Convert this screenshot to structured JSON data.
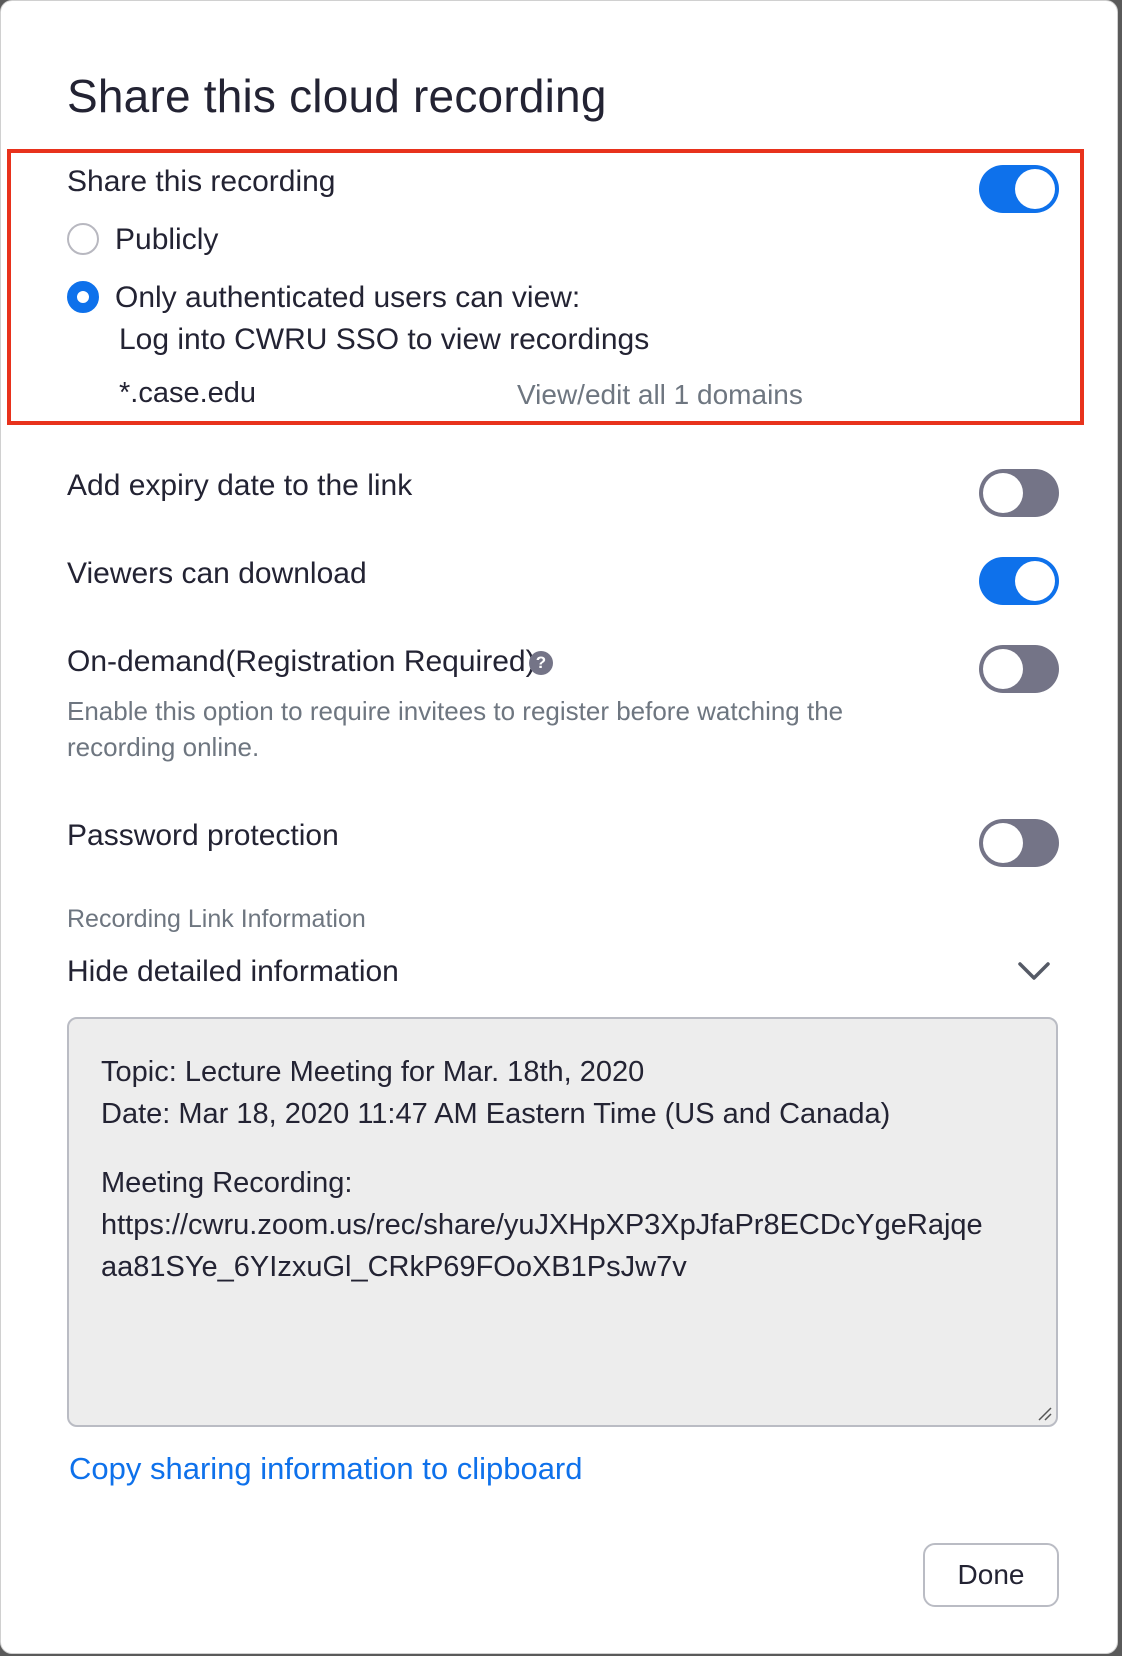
{
  "dialog": {
    "title": "Share this cloud recording"
  },
  "share": {
    "label": "Share this recording",
    "enabled": true,
    "options": [
      {
        "label": "Publicly",
        "selected": false
      },
      {
        "label": "Only authenticated users can view:",
        "selected": true
      }
    ],
    "auth_profile": "Log into CWRU SSO to view recordings",
    "domain": "*.case.edu",
    "domains_link": "View/edit all 1 domains"
  },
  "settings": {
    "expiry": {
      "label": "Add expiry date to the link",
      "enabled": false
    },
    "download": {
      "label": "Viewers can download",
      "enabled": true
    },
    "on_demand": {
      "label": "On-demand(Registration Required)",
      "help_glyph": "?",
      "description": "Enable this option to require invitees to register before watching the recording online.",
      "enabled": false
    },
    "password": {
      "label": "Password protection",
      "enabled": false
    }
  },
  "link_info": {
    "section_label": "Recording Link Information",
    "toggle_label": "Hide detailed information",
    "lines": [
      "Topic: Lecture Meeting for Mar. 18th, 2020",
      "Date: Mar 18, 2020 11:47 AM Eastern Time (US and Canada)",
      "",
      "Meeting Recording:",
      "https://cwru.zoom.us/rec/share/yuJXHpXP3XpJfaPr8ECDcYgeRajqe",
      "aa81SYe_6YIzxuGl_CRkP69FOoXB1PsJw7v"
    ]
  },
  "actions": {
    "copy_label": "Copy sharing information to clipboard",
    "done_label": "Done"
  },
  "colors": {
    "accent": "#0e71eb",
    "highlight_border": "#e8321c",
    "toggle_off": "#747487"
  }
}
